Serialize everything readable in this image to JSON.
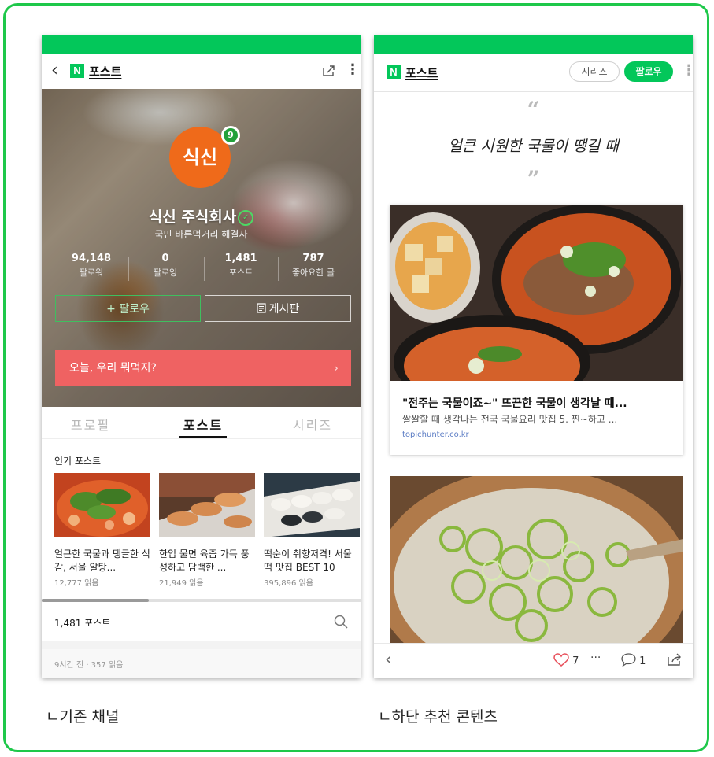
{
  "left_phone": {
    "header": {
      "logo": "N",
      "title": "포스트"
    },
    "channel": {
      "logo_text": "식신",
      "badge": "9",
      "name": "식신 주식회사",
      "subtitle": "국민 바른먹거리 해결사",
      "stats": [
        {
          "value": "94,148",
          "label": "팔로워"
        },
        {
          "value": "0",
          "label": "팔로잉"
        },
        {
          "value": "1,481",
          "label": "포스트"
        },
        {
          "value": "787",
          "label": "좋아요한 글"
        }
      ],
      "follow_button": "+ 팔로우",
      "board_button": "게시판",
      "today_button": "오늘, 우리 뭐먹지?"
    },
    "tabs": [
      "프로필",
      "포스트",
      "시리즈"
    ],
    "popular": {
      "title": "인기 포스트",
      "items": [
        {
          "title": "얼큰한 국물과 탱글한 식감, 서울 알탕...",
          "reads": "12,777 읽음"
        },
        {
          "title": "한입 물면 육즙 가득 풍성하고 담백한 ...",
          "reads": "21,949 읽음"
        },
        {
          "title": "떡순이 취향저격! 서울 떡 맛집 BEST 10",
          "reads": "395,896 읽음"
        }
      ]
    },
    "post_count": "1,481 포스트",
    "meta": "9시간 전 · 357 읽음"
  },
  "right_phone": {
    "header": {
      "logo": "N",
      "title": "포스트",
      "series_button": "시리즈",
      "follow_button": "팔로우"
    },
    "quote": {
      "open": "“",
      "text": "얼큰 시원한 국물이 땡길 때",
      "close": "”"
    },
    "article": {
      "title": "\"전주는 국물이죠~\" 뜨끈한 국물이 생각날 때...",
      "desc": "쌀쌀할 때 생각나는 전국 국물요리 맛집 5. 찐~하고 ...",
      "source": "topichunter.co.kr"
    },
    "bottom_bar": {
      "likes": "7",
      "more": "···",
      "comments": "1"
    }
  },
  "captions": {
    "left": "ㄴ기존 채널",
    "right": "ㄴ하단 추천 콘텐츠"
  },
  "colors": {
    "naver_green": "#03c75a",
    "frame_green": "#1ec84a",
    "today_red": "#ef6262",
    "logo_orange": "#ef6a1a"
  }
}
